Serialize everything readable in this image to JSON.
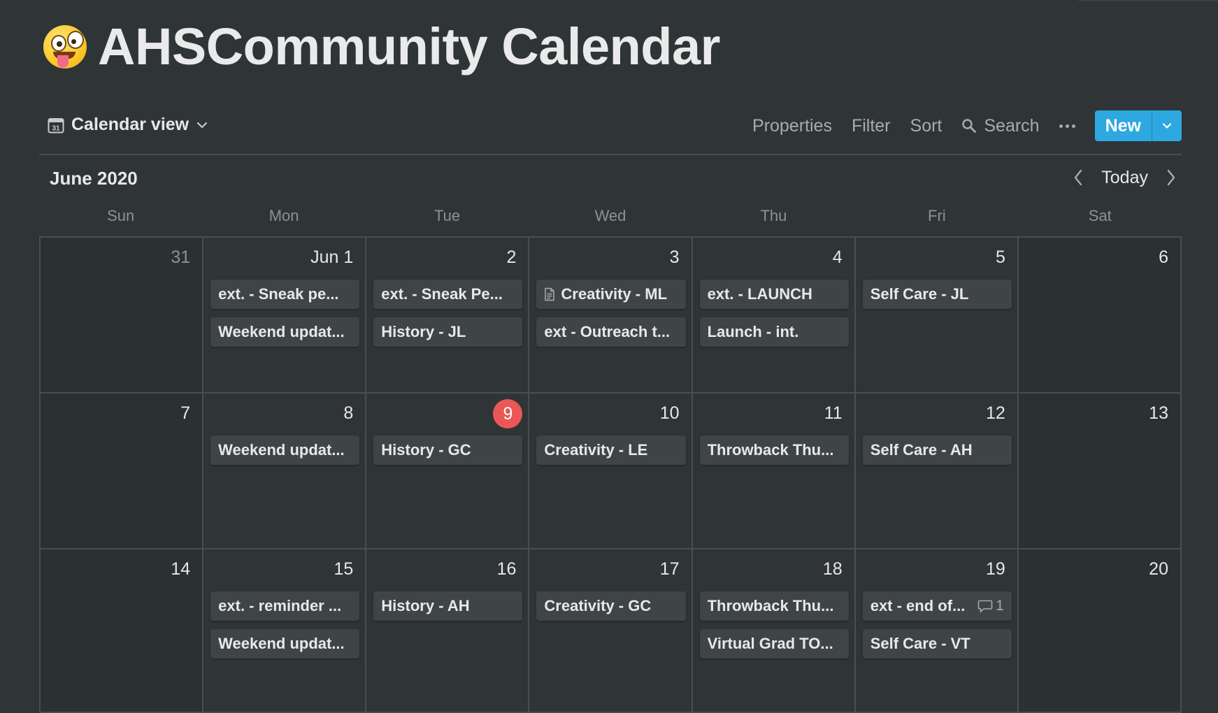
{
  "page": {
    "title": "AHSCommunity Calendar",
    "emoji": "zany-face-emoji"
  },
  "toolbar": {
    "view_label": "Calendar view",
    "properties": "Properties",
    "filter": "Filter",
    "sort": "Sort",
    "search": "Search",
    "new": "New"
  },
  "month": {
    "label": "June 2020",
    "today": "Today"
  },
  "weekdays": [
    "Sun",
    "Mon",
    "Tue",
    "Wed",
    "Thu",
    "Fri",
    "Sat"
  ],
  "colors": {
    "background": "#2f3437",
    "accent": "#2ea8e0",
    "today": "#eb5757",
    "event_card": "#3f4447"
  },
  "weeks": [
    {
      "days": [
        {
          "label": "31",
          "faded": true,
          "events": []
        },
        {
          "label": "Jun 1",
          "events": [
            {
              "text": "ext. - Sneak pe..."
            },
            {
              "text": "Weekend updat..."
            }
          ]
        },
        {
          "label": "2",
          "events": [
            {
              "text": "ext. - Sneak Pe..."
            },
            {
              "text": "History - JL"
            }
          ]
        },
        {
          "label": "3",
          "events": [
            {
              "text": "Creativity - ML",
              "icon": "page-icon"
            },
            {
              "text": "ext - Outreach t..."
            }
          ]
        },
        {
          "label": "4",
          "events": [
            {
              "text": "ext. - LAUNCH"
            },
            {
              "text": "Launch - int."
            }
          ]
        },
        {
          "label": "5",
          "events": [
            {
              "text": "Self Care - JL"
            }
          ]
        },
        {
          "label": "6",
          "events": []
        }
      ]
    },
    {
      "days": [
        {
          "label": "7",
          "events": []
        },
        {
          "label": "8",
          "events": [
            {
              "text": "Weekend updat..."
            }
          ]
        },
        {
          "label": "9",
          "today": true,
          "events": [
            {
              "text": "History - GC"
            }
          ]
        },
        {
          "label": "10",
          "events": [
            {
              "text": "Creativity - LE"
            }
          ]
        },
        {
          "label": "11",
          "events": [
            {
              "text": "Throwback Thu..."
            }
          ]
        },
        {
          "label": "12",
          "events": [
            {
              "text": "Self Care - AH"
            }
          ]
        },
        {
          "label": "13",
          "events": []
        }
      ]
    },
    {
      "days": [
        {
          "label": "14",
          "events": []
        },
        {
          "label": "15",
          "events": [
            {
              "text": "ext. - reminder ..."
            },
            {
              "text": "Weekend updat..."
            }
          ]
        },
        {
          "label": "16",
          "events": [
            {
              "text": "History - AH"
            }
          ]
        },
        {
          "label": "17",
          "events": [
            {
              "text": "Creativity - GC"
            }
          ]
        },
        {
          "label": "18",
          "events": [
            {
              "text": "Throwback Thu..."
            },
            {
              "text": "Virtual Grad TO..."
            }
          ]
        },
        {
          "label": "19",
          "events": [
            {
              "text": "ext - end of...",
              "comments": "1"
            },
            {
              "text": "Self Care - VT"
            }
          ]
        },
        {
          "label": "20",
          "events": []
        }
      ]
    }
  ]
}
